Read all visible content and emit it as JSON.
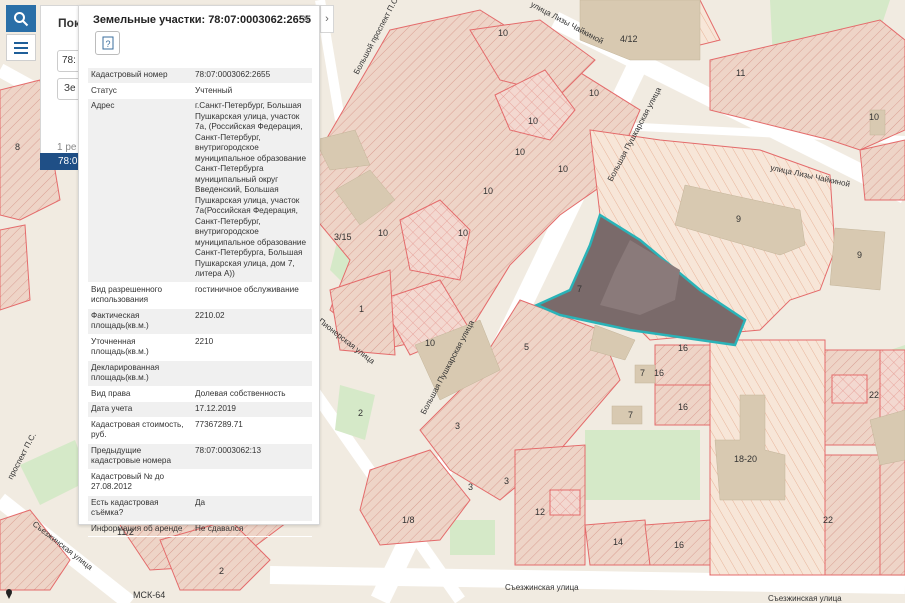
{
  "search_panel": {
    "title": "Пок",
    "input_value": "78:",
    "select_value": "Зе",
    "results_count": "1 ре",
    "selected_result": "78:0"
  },
  "card": {
    "title": "Земельные участки: 78:07:0003062:2655",
    "icon_label": "?",
    "properties": [
      {
        "key": "Кадастровый номер",
        "value": "78:07:0003062:2655"
      },
      {
        "key": "Статус",
        "value": "Учтенный"
      },
      {
        "key": "Адрес",
        "value": "г.Санкт-Петербург, Большая Пушкарская улица, участок 7а, (Российская Федерация, Санкт-Петербург, внутригородское муниципальное образование Санкт-Петербурга муниципальный округ Введенский, Большая Пушкарская улица, участок 7а(Российская Федерация, Санкт-Петербург, внутригородское муниципальное образование Санкт-Петербурга, Большая Пушкарская улица, дом 7, литера А))"
      },
      {
        "key": "Вид разрешенного использования",
        "value": "гостиничное обслуживание"
      },
      {
        "key": "Фактическая площадь(кв.м.)",
        "value": "2210.02"
      },
      {
        "key": "Уточненная площадь(кв.м.)",
        "value": "2210"
      },
      {
        "key": "Декларированная площадь(кв.м.)",
        "value": ""
      },
      {
        "key": "Вид права",
        "value": "Долевая собственность"
      },
      {
        "key": "Дата учета",
        "value": "17.12.2019"
      },
      {
        "key": "Кадастровая стоимость, руб.",
        "value": "77367289.71"
      },
      {
        "key": "Предыдущие кадастровые номера",
        "value": "78:07:0003062:13"
      },
      {
        "key": "Кадастровый № до 27.08.2012",
        "value": ""
      },
      {
        "key": "Есть кадастровая съёмка?",
        "value": "Да"
      },
      {
        "key": "Информация об аренде",
        "value": "Не сдавался"
      }
    ]
  },
  "map": {
    "crs_label": "МСК-64",
    "streets": {
      "s1": "улица Лизы Чайкиной",
      "s2": "улица Лизы Чайкиной",
      "s3": "Большая Пушкарская улица",
      "s4": "Большая Пушкарская улица",
      "s5": "Пионерская улица",
      "s6": "Съезжинская улица",
      "s7": "Съезжинская улица",
      "s8": "Съезжинская улица",
      "s9": "Большой проспект П.С.",
      "s10": "проспект П.С."
    },
    "house_numbers": [
      "8",
      "10",
      "10",
      "10",
      "10",
      "10",
      "10",
      "10",
      "3/15",
      "1",
      "10",
      "10",
      "4/12",
      "11",
      "10",
      "9",
      "9",
      "7",
      "5",
      "16",
      "7",
      "16",
      "16",
      "7",
      "2",
      "3",
      "3",
      "3",
      "12",
      "14",
      "16",
      "18-20",
      "22",
      "22",
      "1/8",
      "11/2",
      "2"
    ],
    "colors": {
      "parcel_fill": "#e9c6b9",
      "parcel_stroke": "#e46b6b",
      "selected_fill": "#7a6a6a",
      "selected_stroke": "#2ab3b8",
      "building": "#d6c7b0",
      "green": "#cfe8c1",
      "road": "#ffffff"
    }
  }
}
